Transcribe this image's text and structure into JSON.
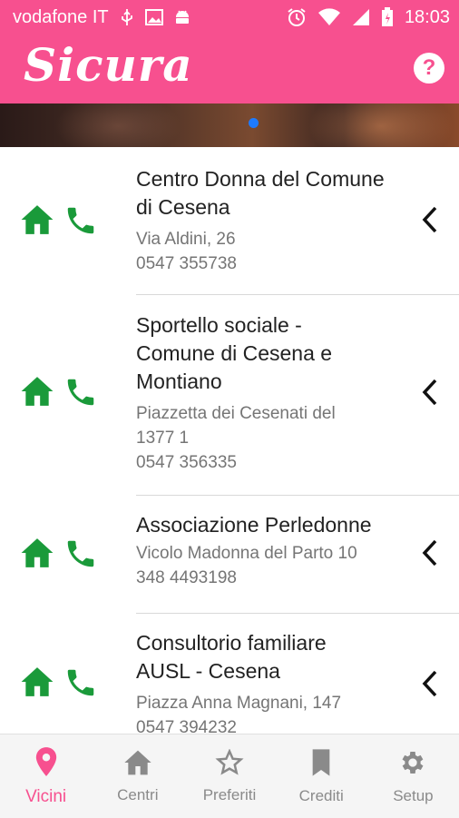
{
  "status_bar": {
    "carrier": "vodafone IT",
    "time": "18:03"
  },
  "app": {
    "title": "Sicura",
    "help_label": "?"
  },
  "colors": {
    "accent": "#f7508f",
    "icon_green": "#1a9a3a",
    "page_indicator": "#1e7bff"
  },
  "list": [
    {
      "name_lines": [
        "Centro Donna del Comune",
        "di Cesena"
      ],
      "address_lines": [
        "Via Aldini, 26"
      ],
      "phone": "0547 355738"
    },
    {
      "name_lines": [
        "Sportello sociale -",
        "Comune di Cesena e",
        "Montiano"
      ],
      "address_lines": [
        "Piazzetta dei Cesenati del",
        "1377 1"
      ],
      "phone": "0547 356335"
    },
    {
      "name_lines": [
        "Associazione Perledonne"
      ],
      "address_lines": [
        "Vicolo Madonna del Parto 10"
      ],
      "phone": "348 4493198"
    },
    {
      "name_lines": [
        "Consultorio familiare",
        "AUSL - Cesena"
      ],
      "address_lines": [
        "Piazza Anna Magnani, 147"
      ],
      "phone": "0547 394232"
    }
  ],
  "bottom_nav": [
    {
      "label": "Vicini",
      "icon": "location-pin-icon",
      "active": true
    },
    {
      "label": "Centri",
      "icon": "home-icon",
      "active": false
    },
    {
      "label": "Preferiti",
      "icon": "star-icon",
      "active": false
    },
    {
      "label": "Crediti",
      "icon": "bookmark-icon",
      "active": false
    },
    {
      "label": "Setup",
      "icon": "gear-icon",
      "active": false
    }
  ]
}
